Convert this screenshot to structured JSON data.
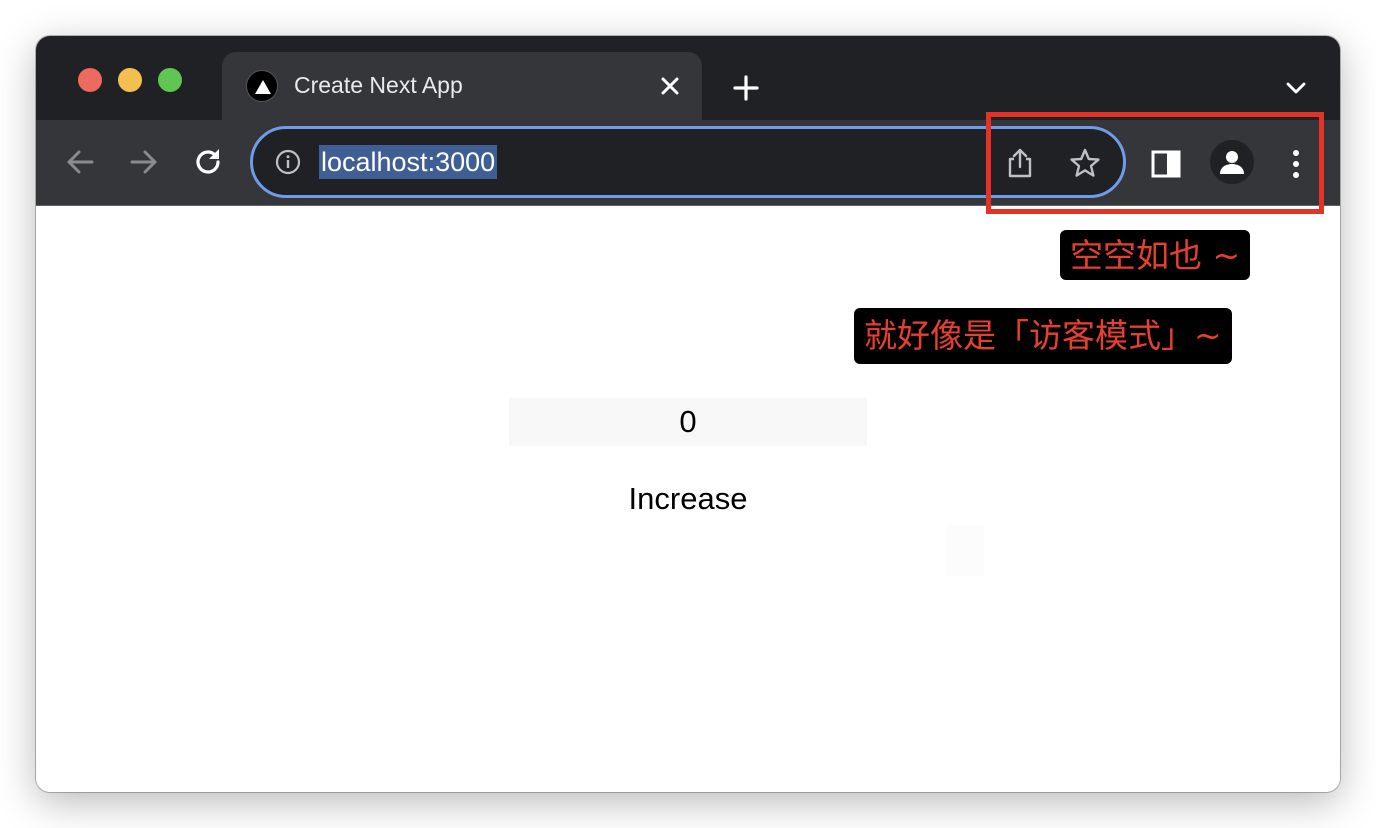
{
  "browser": {
    "tab": {
      "title": "Create Next App",
      "favicon": "nextjs-triangle-icon"
    },
    "address_bar": {
      "url": "localhost:3000"
    },
    "icons": {
      "back": "arrow-left-icon",
      "forward": "arrow-right-icon",
      "reload": "reload-icon",
      "info": "info-icon",
      "share": "share-icon",
      "bookmark": "star-icon",
      "side_panel": "side-panel-icon",
      "profile": "person-icon",
      "menu": "kebab-menu-icon",
      "close_tab": "close-icon",
      "new_tab": "plus-icon",
      "tab_search": "chevron-down-icon"
    },
    "colors": {
      "titlebar": "#202124",
      "toolbar": "#35363a",
      "omnibox_border": "#6e9cec",
      "url_selection": "#3e5e94"
    }
  },
  "page": {
    "counter_value": "0",
    "increase_label": "Increase"
  },
  "annotations": {
    "highlight_color": "#e53226",
    "note_1": "空空如也 ~",
    "note_2": "就好像是「访客模式」~"
  }
}
